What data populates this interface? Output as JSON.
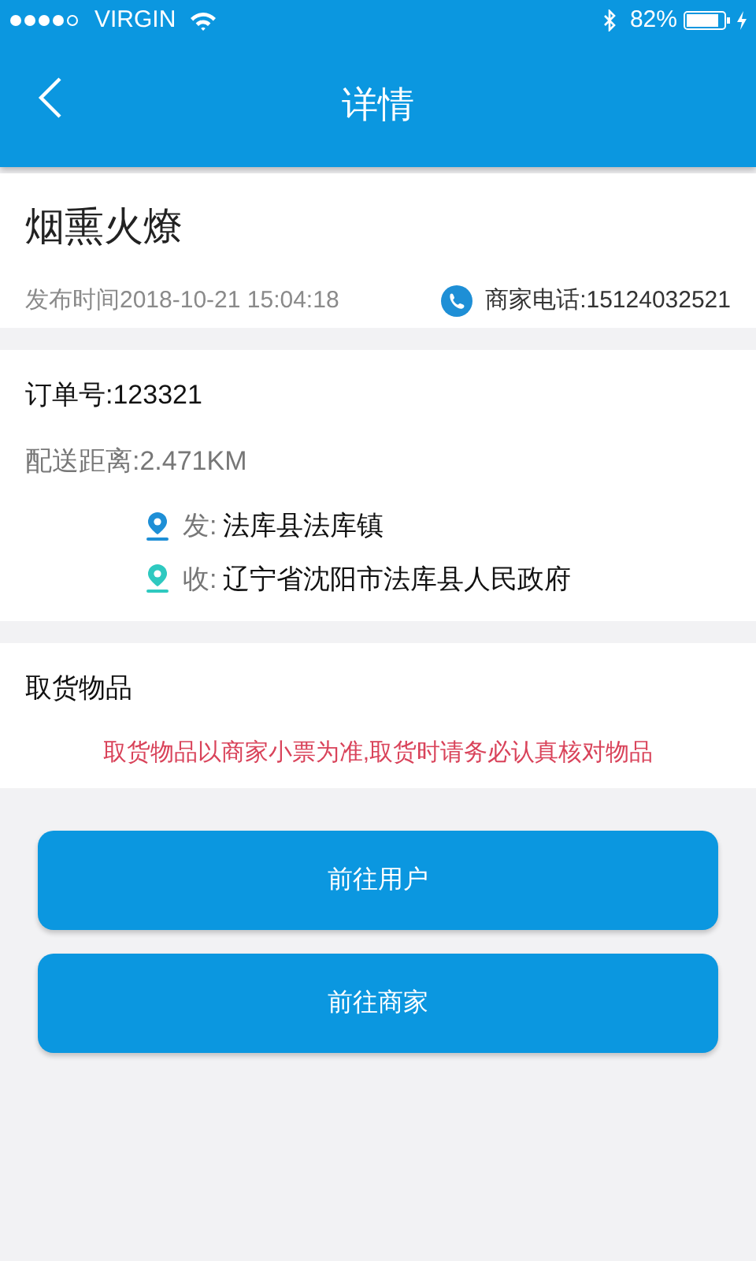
{
  "status_bar": {
    "carrier": "VIRGIN",
    "battery": "82%"
  },
  "header": {
    "title": "详情"
  },
  "shop": {
    "name": "烟熏火燎",
    "published": "发布时间2018-10-21 15:04:18",
    "phone": "商家电话:15124032521"
  },
  "order": {
    "number": "订单号:123321",
    "distance": "配送距离:2.471KM",
    "addresses": [
      {
        "label": "发:",
        "address": "法库县法库镇",
        "color": "#1e8fd6"
      },
      {
        "label": "收:",
        "address": "辽宁省沈阳市法库县人民政府",
        "color": "#2ec9c0"
      }
    ]
  },
  "goods": {
    "title": "取货物品",
    "notice": "取货物品以商家小票为准,取货时请务必认真核对物品"
  },
  "buttons": [
    "前往用户",
    "前往商家"
  ]
}
